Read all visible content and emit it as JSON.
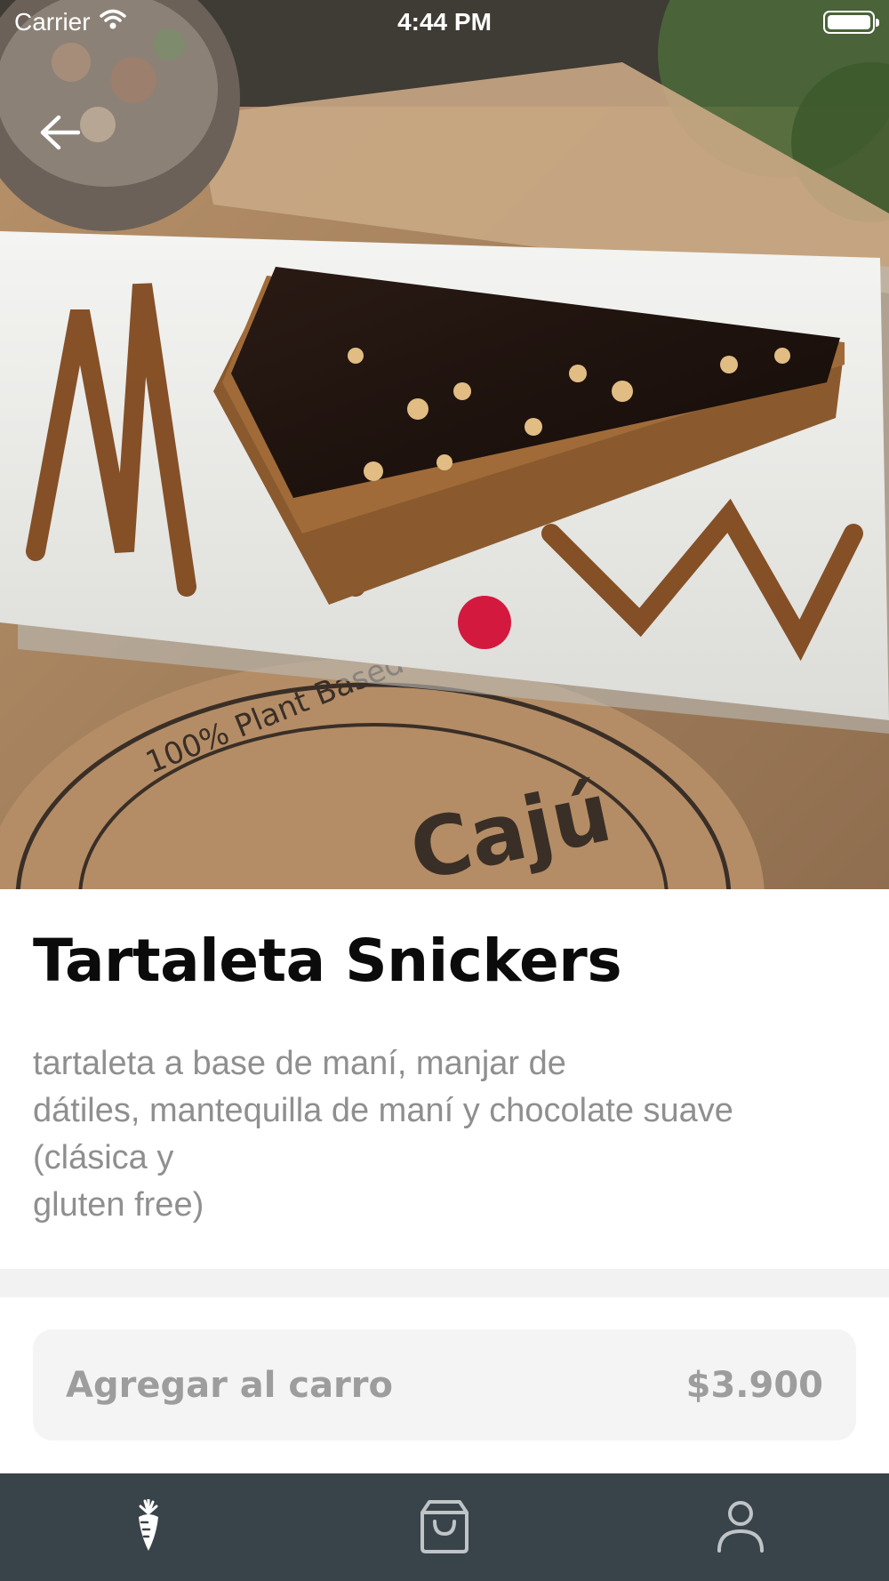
{
  "status_bar": {
    "carrier": "Carrier",
    "time": "4:44 PM"
  },
  "hero": {
    "plate_stamp_text": "100% Plant Based",
    "plate_brand_text": "Cajú"
  },
  "product": {
    "title": "Tartaleta Snickers",
    "description": "tartaleta a base de maní, manjar de\ndátiles, mantequilla de maní y chocolate suave\n(clásica y\ngluten free)"
  },
  "cart": {
    "label": "Agregar al carro",
    "price": "$3.900"
  },
  "tabs": [
    {
      "icon": "carrot-icon",
      "active": true
    },
    {
      "icon": "shopping-bag-icon",
      "active": false
    },
    {
      "icon": "user-icon",
      "active": false
    }
  ],
  "colors": {
    "tab_bar_bg": "#39444a",
    "tab_active": "#ffffff",
    "tab_inactive": "#bfc4c7",
    "button_bg": "#f4f4f4",
    "button_text": "#9d9d9d",
    "description_text": "#8f8f8f"
  }
}
